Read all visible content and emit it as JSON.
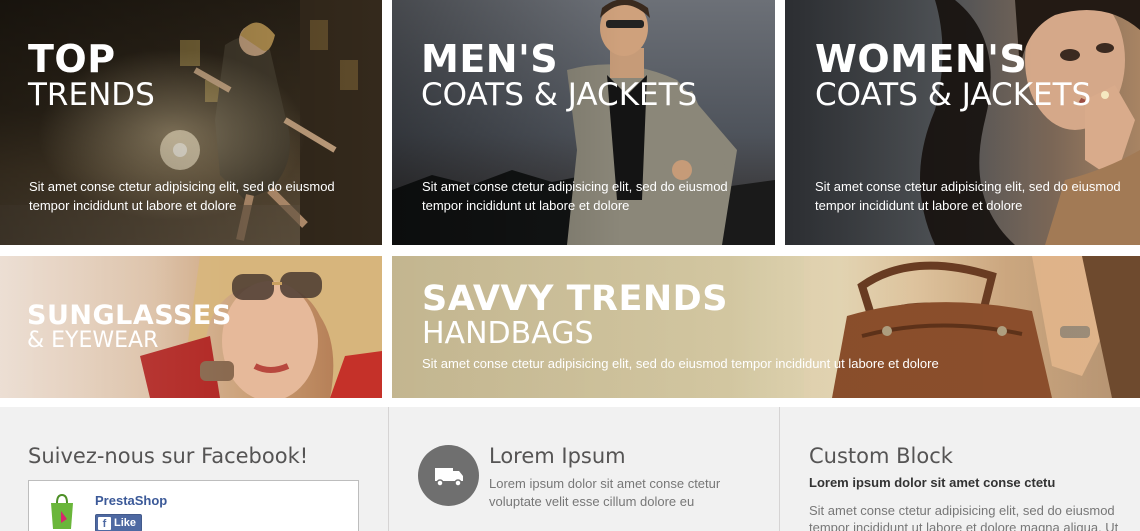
{
  "banners": {
    "top_trends": {
      "title_big": "TOP",
      "title_small": "TRENDS",
      "description": "Sit amet conse ctetur adipisicing elit, sed do eiusmod tempor incididunt ut labore et dolore"
    },
    "mens_coats": {
      "title_big": "MEN'S",
      "title_small": "COATS & JACKETS",
      "description": "Sit amet conse ctetur adipisicing elit, sed do eiusmod tempor incididunt ut labore et dolore"
    },
    "womens_coats": {
      "title_big": "WOMEN'S",
      "title_small": "COATS & JACKETS",
      "description": "Sit amet conse ctetur adipisicing elit, sed do eiusmod tempor incididunt ut labore et dolore"
    },
    "sunglasses": {
      "title_big": "SUNGLASSES",
      "title_small": "& EYEWEAR"
    },
    "handbags": {
      "title_big": "SAVVY TRENDS",
      "title_small": "HANDBAGS",
      "description": "Sit amet conse ctetur adipisicing elit, sed do eiusmod tempor incididunt ut labore et dolore"
    }
  },
  "facebook": {
    "title": "Suivez-nous sur Facebook!",
    "page_name": "PrestaShop",
    "like_label": "Like",
    "like_icon": "facebook-f-icon"
  },
  "info_block": {
    "icon": "truck-icon",
    "title": "Lorem Ipsum",
    "text": "Lorem ipsum dolor sit amet conse ctetur voluptate velit esse cillum dolore eu"
  },
  "custom_block": {
    "title": "Custom Block",
    "subtitle": "Lorem ipsum dolor sit amet conse ctetu",
    "text": "Sit amet conse ctetur adipisicing elit, sed do eiusmod tempor incididunt ut labore et dolore magna aliqua. Ut"
  },
  "colors": {
    "footer_bg": "#f1f1f1",
    "facebook_blue": "#3b5998",
    "like_button": "#4e69a2",
    "heading_gray": "#555454",
    "text_gray": "#777777"
  }
}
